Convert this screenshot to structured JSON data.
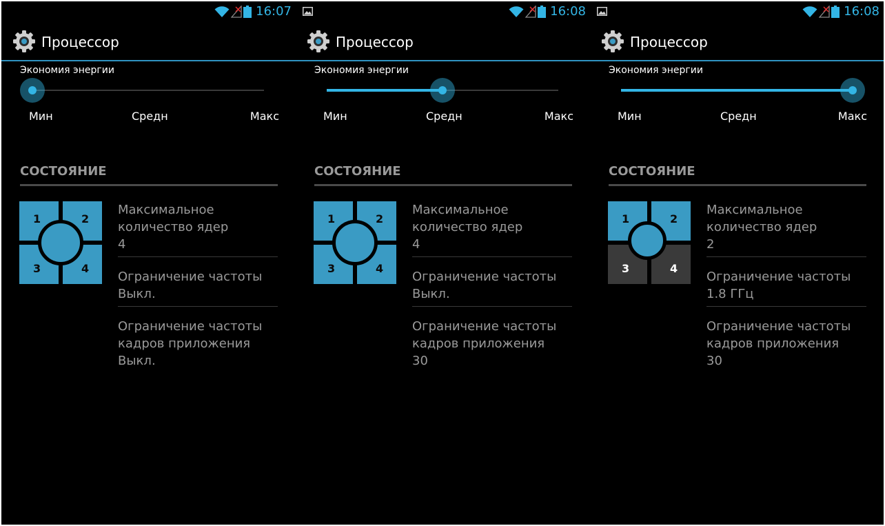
{
  "screens": [
    {
      "status": {
        "time": "16:07",
        "left_icon": ""
      },
      "action_bar": {
        "title": "Процессор",
        "icon": "gear-icon"
      },
      "power_saving": {
        "title": "Экономия энергии",
        "labels": [
          "Мин",
          "Средн",
          "Макс"
        ],
        "level": 0.0
      },
      "section": {
        "title": "СОСТОЯНИЕ"
      },
      "cores": {
        "labels": [
          "1",
          "2",
          "3",
          "4"
        ],
        "active": [
          true,
          true,
          true,
          true
        ]
      },
      "info": [
        {
          "label": "Максимальное количество ядер",
          "value": "4"
        },
        {
          "label": "Ограничение частоты",
          "value": "Выкл."
        },
        {
          "label": "Ограничение частоты кадров приложения",
          "value": "Выкл."
        }
      ]
    },
    {
      "status": {
        "time": "16:08",
        "left_icon": "image-icon"
      },
      "action_bar": {
        "title": "Процессор",
        "icon": "gear-icon"
      },
      "power_saving": {
        "title": "Экономия энергии",
        "labels": [
          "Мин",
          "Средн",
          "Макс"
        ],
        "level": 0.5
      },
      "section": {
        "title": "СОСТОЯНИЕ"
      },
      "cores": {
        "labels": [
          "1",
          "2",
          "3",
          "4"
        ],
        "active": [
          true,
          true,
          true,
          true
        ]
      },
      "info": [
        {
          "label": "Максимальное количество ядер",
          "value": "4"
        },
        {
          "label": "Ограничение частоты",
          "value": "Выкл."
        },
        {
          "label": "Ограничение частоты кадров приложения",
          "value": "30"
        }
      ]
    },
    {
      "status": {
        "time": "16:08",
        "left_icon": "image-icon"
      },
      "action_bar": {
        "title": "Процессор",
        "icon": "gear-icon"
      },
      "power_saving": {
        "title": "Экономия энергии",
        "labels": [
          "Мин",
          "Средн",
          "Макс"
        ],
        "level": 1.0
      },
      "section": {
        "title": "СОСТОЯНИЕ"
      },
      "cores": {
        "labels": [
          "1",
          "2",
          "3",
          "4"
        ],
        "active": [
          true,
          true,
          false,
          false
        ]
      },
      "info": [
        {
          "label": "Максимальное количество ядер",
          "value": "2"
        },
        {
          "label": "Ограничение частоты",
          "value": "1.8 ГГц"
        },
        {
          "label": "Ограничение частоты кадров приложения",
          "value": "30"
        }
      ]
    }
  ],
  "colors": {
    "accent": "#33b5e5",
    "core_active": "#3a9bc4",
    "core_inactive": "#3a3a3a",
    "text_secondary": "#9a9a9a"
  }
}
